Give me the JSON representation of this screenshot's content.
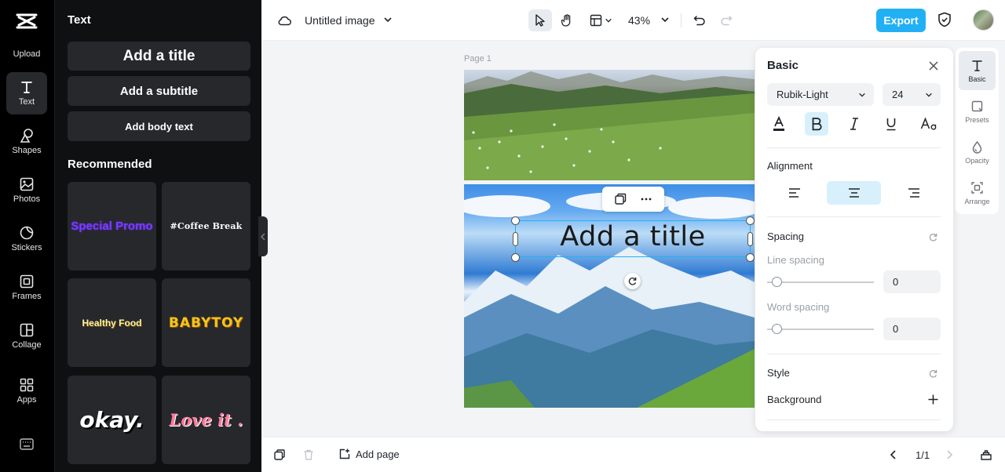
{
  "rail": {
    "items": [
      {
        "label": "Upload"
      },
      {
        "label": "Text"
      },
      {
        "label": "Shapes"
      },
      {
        "label": "Photos"
      },
      {
        "label": "Stickers"
      },
      {
        "label": "Frames"
      },
      {
        "label": "Collage"
      },
      {
        "label": "Apps"
      }
    ]
  },
  "panel": {
    "title": "Text",
    "add_title": "Add a title",
    "add_subtitle": "Add a subtitle",
    "add_body": "Add body text",
    "recommended": "Recommended",
    "templates": [
      "Special Promo",
      "#Coffee Break",
      "Healthy Food",
      "BABYTOY",
      "okay.",
      "Love it ."
    ]
  },
  "topbar": {
    "doc_title": "Untitled image",
    "zoom": "43%",
    "export": "Export"
  },
  "canvas": {
    "page_label": "Page 1",
    "text": "Add a title"
  },
  "props": {
    "title": "Basic",
    "font": "Rubik-Light",
    "size": "24",
    "alignment_label": "Alignment",
    "spacing_label": "Spacing",
    "line_spacing_label": "Line spacing",
    "line_spacing_value": "0",
    "word_spacing_label": "Word spacing",
    "word_spacing_value": "0",
    "style_label": "Style",
    "background_label": "Background"
  },
  "rstrip": {
    "items": [
      {
        "label": "Basic"
      },
      {
        "label": "Presets"
      },
      {
        "label": "Opacity"
      },
      {
        "label": "Arrange"
      }
    ]
  },
  "bottombar": {
    "add_page": "Add page",
    "pager": "1/1"
  },
  "colors": {
    "accent": "#22b0f5",
    "selection_bg": "#d8f0fb",
    "rail_bg": "#000000",
    "panel_bg": "#0f1012"
  }
}
